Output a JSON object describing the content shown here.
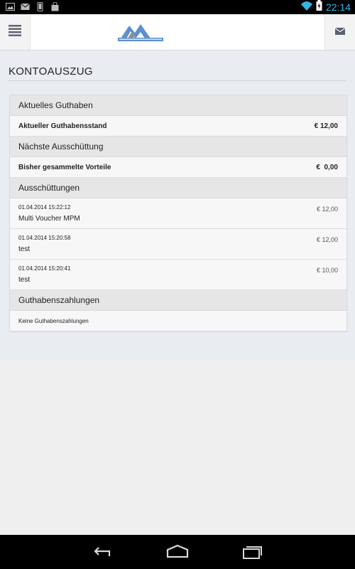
{
  "status_bar": {
    "time": "22:14",
    "left_icons": [
      "picture-icon",
      "gmail-icon",
      "phone-icon",
      "shopping-bag-icon"
    ],
    "right_icons": [
      "wifi-icon",
      "battery-charging-icon"
    ]
  },
  "app_bar": {
    "menu_icon": "hamburger-menu-icon",
    "mail_icon": "envelope-icon"
  },
  "page": {
    "title": "KONTOAUSZUG"
  },
  "sections": {
    "current_balance": {
      "header": "Aktuelles Guthaben",
      "row_label": "Aktueller Guthabensstand",
      "row_value": "€ 12,00"
    },
    "next_payout": {
      "header": "Nächste Ausschüttung",
      "row_label": "Bisher gesammelte Vorteile",
      "row_value": "€  0,00"
    },
    "payouts": {
      "header": "Ausschüttungen",
      "items": [
        {
          "date": "01.04.2014 15:22:12",
          "name": "Multi Voucher MPM",
          "amount": "€ 12,00"
        },
        {
          "date": "01.04.2014 15:20:58",
          "name": "test",
          "amount": "€ 12,00"
        },
        {
          "date": "01.04.2014 15:20:41",
          "name": "test",
          "amount": "€ 10,00"
        }
      ]
    },
    "credit_payments": {
      "header": "Guthabenszahlungen",
      "empty_text": "Keine Guthabenszahlungen"
    }
  },
  "nav_bar": {
    "icons": [
      "back-icon",
      "home-icon",
      "recent-apps-icon"
    ]
  },
  "colors": {
    "accent": "#33b5e5",
    "logo_blue": "#5b8fd0",
    "logo_gray": "#8a8f96"
  }
}
